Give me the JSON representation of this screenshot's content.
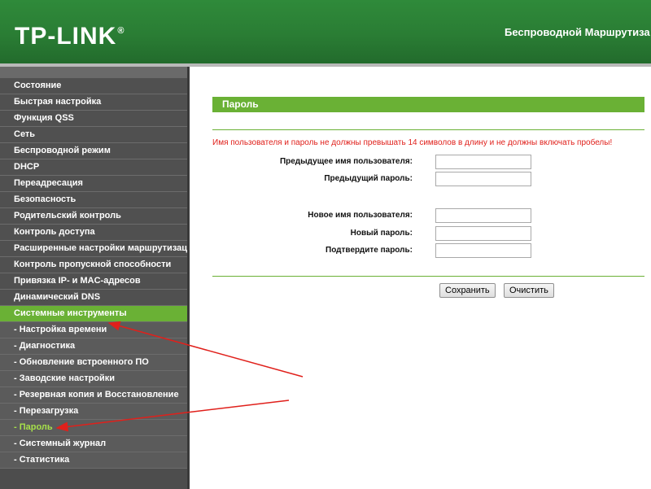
{
  "header": {
    "brand": "TP-LINK",
    "model_title": "Беспроводной Маршрутиза"
  },
  "sidebar": {
    "items": [
      {
        "label": "Состояние"
      },
      {
        "label": "Быстрая настройка"
      },
      {
        "label": "Функция QSS"
      },
      {
        "label": "Сеть"
      },
      {
        "label": "Беспроводной режим"
      },
      {
        "label": "DHCP"
      },
      {
        "label": "Переадресация"
      },
      {
        "label": "Безопасность"
      },
      {
        "label": "Родительский контроль"
      },
      {
        "label": "Контроль доступа"
      },
      {
        "label": "Расширенные настройки маршрутизации"
      },
      {
        "label": "Контроль пропускной способности"
      },
      {
        "label": "Привязка IP- и MAC-адресов"
      },
      {
        "label": "Динамический DNS"
      },
      {
        "label": "Системные инструменты"
      },
      {
        "label": "- Настройка времени"
      },
      {
        "label": "- Диагностика"
      },
      {
        "label": "- Обновление встроенного ПО"
      },
      {
        "label": "- Заводские настройки"
      },
      {
        "label": "- Резервная копия и Восстановление"
      },
      {
        "label": "- Перезагрузка"
      },
      {
        "label": "- Пароль"
      },
      {
        "label": "- Системный журнал"
      },
      {
        "label": "- Статистика"
      }
    ]
  },
  "content": {
    "title": "Пароль",
    "warning": "Имя пользователя и пароль не должны превышать 14 символов в длину и не должны включать пробелы!",
    "fields": {
      "old_user": {
        "label": "Предыдущее имя пользователя:",
        "value": ""
      },
      "old_pass": {
        "label": "Предыдущий пароль:",
        "value": ""
      },
      "new_user": {
        "label": "Новое имя пользователя:",
        "value": ""
      },
      "new_pass": {
        "label": "Новый пароль:",
        "value": ""
      },
      "confirm_pass": {
        "label": "Подтвердите пароль:",
        "value": ""
      }
    },
    "buttons": {
      "save": "Сохранить",
      "clear": "Очистить"
    }
  },
  "colors": {
    "accent_green": "#6ab135",
    "header_green": "#2a7d34",
    "sidebar_bg": "#505050",
    "current_item_text": "#a6e04a",
    "warning_red": "#e0201b",
    "annotation_arrow": "#e0201b"
  }
}
